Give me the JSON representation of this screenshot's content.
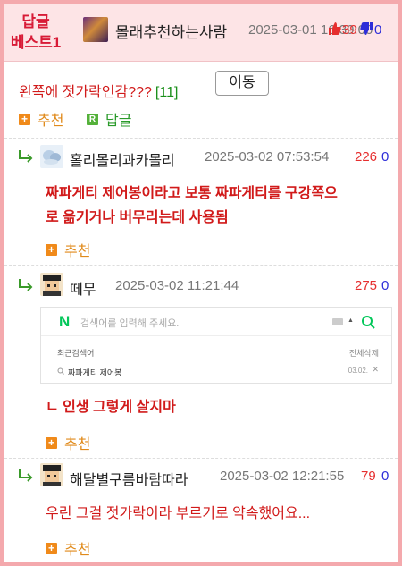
{
  "header": {
    "badge_line1": "답글",
    "badge_line2": "베스트1",
    "author": "몰래추천하는사람",
    "date": "2025-03-01 16:39:00",
    "up_count": "39",
    "down_count": "0"
  },
  "post": {
    "title": "왼쪽에 젓가락인감???",
    "reply_count": "[11]",
    "move_button": "이동",
    "recommend_label": "추천",
    "reply_label": "답글"
  },
  "replies": [
    {
      "author": "홀리몰리과카몰리",
      "date": "2025-03-02 07:53:54",
      "up": "226",
      "down": "0",
      "text_line1": "짜파게티 제어봉이라고 보통 짜파게티를 구강쪽으",
      "text_line2": "로 옮기거나 버무리는데 사용됨",
      "recommend_label": "추천"
    },
    {
      "author": "떼무",
      "date": "2025-03-02 11:21:44",
      "up": "275",
      "down": "0",
      "text_line1": "ㄴ 인생 그렇게 살지마",
      "recommend_label": "추천",
      "capture": {
        "logo": "N",
        "placeholder": "검색어를 입력해 주세요.",
        "recent_label": "최근검색어",
        "clear_label": "전체삭제",
        "item": "짜파게티 제어봉",
        "item_date": "03.02."
      }
    },
    {
      "author": "해달별구름바람따라",
      "date": "2025-03-02 12:21:55",
      "up": "79",
      "down": "0",
      "text_line1": "우린 그걸 젓가락이라 부르기로 약속했어요...",
      "recommend_label": "추천"
    }
  ],
  "colors": {
    "accent_red": "#d11a1a",
    "orange": "#f08a1a",
    "green": "#54b13a",
    "header_bg": "#fde4e6",
    "frame_border": "#f4a9ad"
  }
}
